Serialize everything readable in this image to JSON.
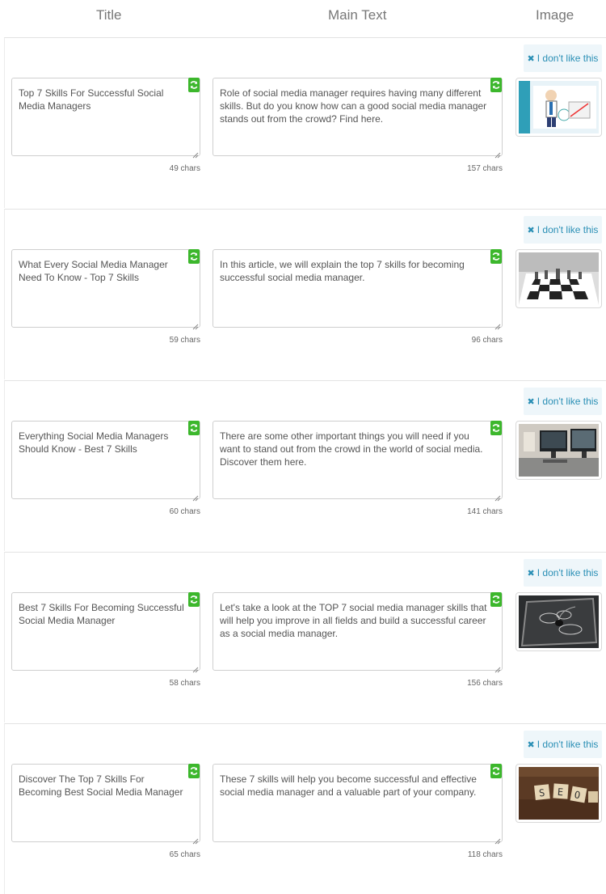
{
  "header": {
    "title": "Title",
    "main_text": "Main Text",
    "image": "Image"
  },
  "dislike_label": "I don't like this",
  "rows": [
    {
      "title": "Top 7 Skills For Successful Social Media Managers",
      "title_count": "49 chars",
      "main": "Role of social media manager requires having many different skills. But do you know how can a good social media manager stands out from the crowd? Find here.",
      "main_count": "157 chars",
      "image": "cartoon-manager-illustration"
    },
    {
      "title": "What Every Social Media Manager Need To Know - Top 7 Skills",
      "title_count": "59 chars",
      "main": " In this article, we will explain the top 7 skills for becoming successful social media manager.",
      "main_count": "96 chars",
      "image": "chess-board-photo"
    },
    {
      "title": "Everything Social Media Managers Should Know - Best 7 Skills",
      "title_count": "60 chars",
      "main": "There are some other important things you will need if you want to stand out from the crowd in the world of social media. Discover them here.",
      "main_count": "141 chars",
      "image": "office-desk-photo"
    },
    {
      "title": "Best 7 Skills For Becoming Successful Social Media Manager",
      "title_count": "58 chars",
      "main": "Let's take a look at the TOP 7 social media manager skills that will help you improve in all fields and build a successful career as a social media manager.",
      "main_count": "156 chars",
      "image": "chalkboard-mouse-photo"
    },
    {
      "title": "Discover The Top  7 Skills For Becoming Best Social Media Manager",
      "title_count": "65 chars",
      "main": "These 7 skills will help you become successful and effective social media manager and a valuable part of your company.",
      "main_count": "118 chars",
      "image": "seo-tiles-photo"
    }
  ]
}
